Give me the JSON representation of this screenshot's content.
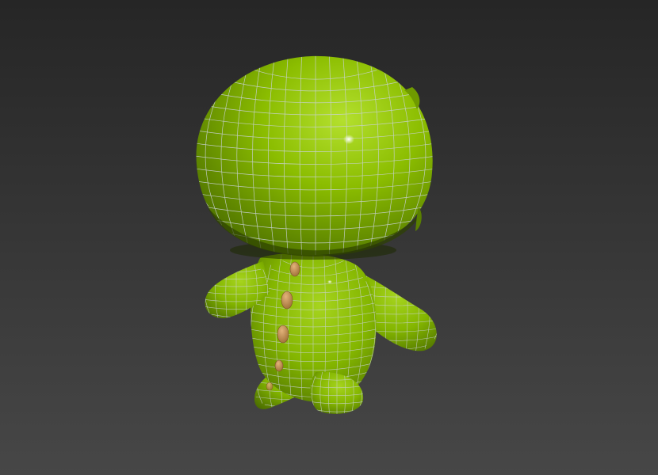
{
  "viewport": {
    "background_top": "#262626",
    "background_bottom": "#474747"
  },
  "model": {
    "body_color": "#86b800",
    "body_highlight": "#b8e23a",
    "body_shadow": "#4c6e00",
    "wire_color": "#c9d2d6",
    "spike_color": "#c8934e",
    "spike_shadow": "#8a5d2a"
  }
}
